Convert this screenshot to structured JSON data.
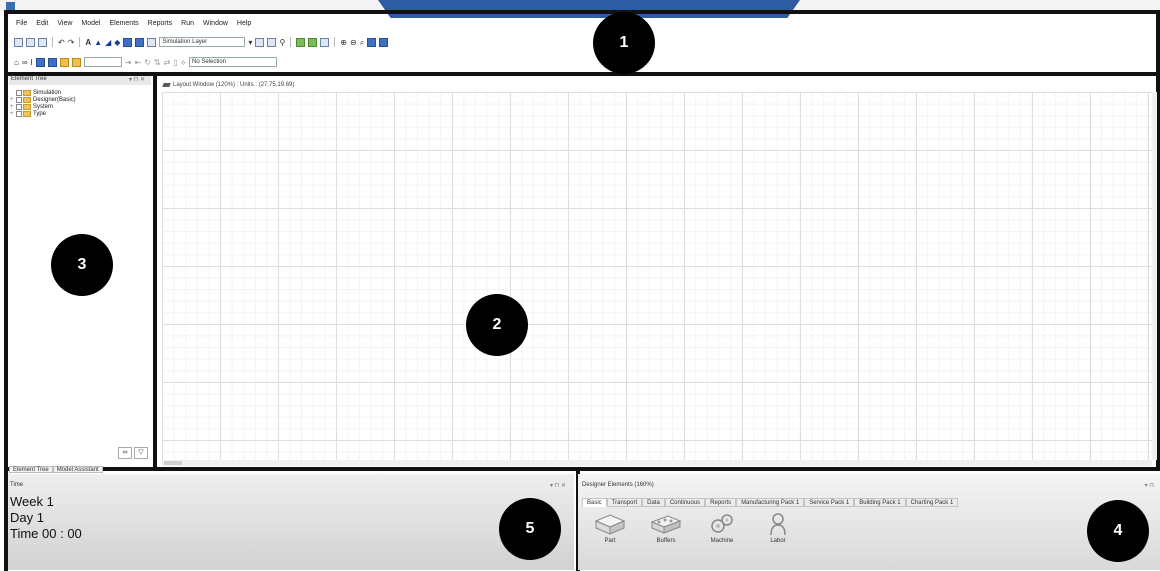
{
  "menu": [
    "File",
    "Edit",
    "View",
    "Model",
    "Elements",
    "Reports",
    "Run",
    "Window",
    "Help"
  ],
  "toolbar": {
    "layer_combo": "Simulation Layer",
    "selection_combo": "No Selection"
  },
  "element_tree": {
    "title": "Element Tree",
    "nodes": [
      "Simulation",
      "Designer(Basic)",
      "System",
      "Type"
    ],
    "tabs": [
      "Element Tree",
      "Model Assistant"
    ]
  },
  "layout_window": {
    "title": "Layout Window (120%) : Units : (27.75,19.69)"
  },
  "time_panel": {
    "title": "Time",
    "week": "Week 1",
    "day": "Day  1",
    "time": "Time 00 : 00"
  },
  "designer": {
    "title": "Designer Elements (160%)",
    "tabs": [
      "Basic",
      "Transport",
      "Data",
      "Continuous",
      "Reports",
      "Manufacturing Pack 1",
      "Service Pack 1",
      "Building Pack 1",
      "Charting Pack 1"
    ],
    "items": [
      "Part",
      "Buffers",
      "Machine",
      "Labor"
    ]
  },
  "callouts": [
    "1",
    "2",
    "3",
    "4",
    "5"
  ]
}
